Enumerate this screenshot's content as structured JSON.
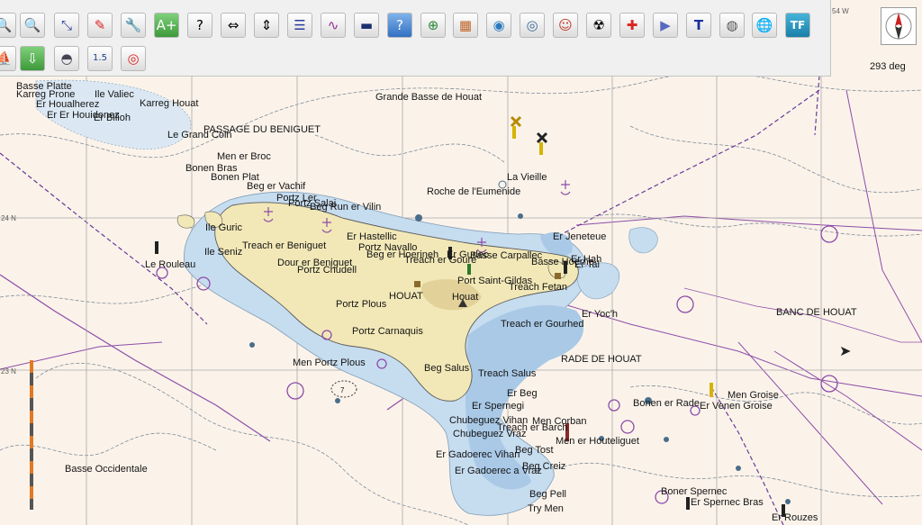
{
  "toolbar": {
    "buttons": [
      {
        "id": "zoom-in",
        "name": "zoom-in-icon",
        "glyph": "🔍"
      },
      {
        "id": "zoom-out",
        "name": "zoom-out-icon",
        "glyph": "🔍"
      },
      {
        "id": "route",
        "name": "route-icon",
        "glyph": "⤡"
      },
      {
        "id": "track",
        "name": "track-icon",
        "glyph": "✎"
      },
      {
        "id": "settings",
        "name": "wrench-icon",
        "glyph": "🔧"
      },
      {
        "id": "add-mark",
        "name": "add-waypoint-icon",
        "glyph": "A+"
      },
      {
        "id": "query",
        "name": "query-icon",
        "glyph": "?"
      },
      {
        "id": "stretch-h",
        "name": "horizontal-stretch-icon",
        "glyph": "⇔"
      },
      {
        "id": "stretch-v",
        "name": "vertical-stretch-icon",
        "glyph": "⇕"
      },
      {
        "id": "route-manager",
        "name": "route-manager-icon",
        "glyph": "☰"
      },
      {
        "id": "tracks",
        "name": "track-manager-icon",
        "glyph": "∿"
      },
      {
        "id": "depth",
        "name": "depth-icon",
        "glyph": "▬"
      },
      {
        "id": "help",
        "name": "help-icon",
        "glyph": "?"
      },
      {
        "id": "target",
        "name": "target-icon",
        "glyph": "⊕"
      },
      {
        "id": "weather",
        "name": "weather-map-icon",
        "glyph": "▦"
      },
      {
        "id": "layers",
        "name": "layers-icon",
        "glyph": "◉"
      },
      {
        "id": "charts",
        "name": "chart-group-icon",
        "glyph": "◎"
      },
      {
        "id": "mob",
        "name": "man-overboard-icon",
        "glyph": "☺"
      },
      {
        "id": "ais",
        "name": "ais-antenna-icon",
        "glyph": "☢"
      },
      {
        "id": "alert",
        "name": "alert-icon",
        "glyph": "✚"
      },
      {
        "id": "dashboard",
        "name": "dashboard-icon",
        "glyph": "▶"
      },
      {
        "id": "text",
        "name": "text-tool-icon",
        "glyph": "T"
      },
      {
        "id": "radar",
        "name": "radar-icon",
        "glyph": "◍"
      },
      {
        "id": "globe",
        "name": "globe-icon",
        "glyph": "🌐"
      },
      {
        "id": "tf",
        "name": "tf-plugin-icon",
        "glyph": "TF"
      },
      {
        "id": "boat",
        "name": "boat-icon",
        "glyph": "⛵"
      },
      {
        "id": "download",
        "name": "download-icon",
        "glyph": "⇩"
      },
      {
        "id": "grib",
        "name": "grib-icon",
        "glyph": "◓"
      },
      {
        "id": "scale",
        "name": "scale-badge-icon",
        "glyph": "1.5"
      },
      {
        "id": "lifebuoy",
        "name": "lifebuoy-icon",
        "glyph": "◎"
      }
    ]
  },
  "status": {
    "heading": "293 deg",
    "lon_top": "54 W",
    "lat_24": "24 N",
    "lat_23": "23 N",
    "compass_icon": "north-arrow-icon"
  },
  "colors": {
    "land": "#f2e8b7",
    "sea": "#fbf3ea",
    "shallow": "#a9c9e6",
    "deep_shallow": "#c6dcef",
    "route_line": "#8d4ca8",
    "grid": "#a8a8a8"
  },
  "labels": [
    {
      "id": "basse-platte",
      "text": "Basse Platte"
    },
    {
      "id": "karreg-prone",
      "text": "Karreg Prone"
    },
    {
      "id": "ile-valiec",
      "text": "Ile Valiec"
    },
    {
      "id": "er-houalherez",
      "text": "Er Houalherez"
    },
    {
      "id": "karreg-houat",
      "text": "Karreg Houat"
    },
    {
      "id": "er-houidenez",
      "text": "Er Er Houidenez"
    },
    {
      "id": "er-bilioh",
      "text": "Er Bilioh"
    },
    {
      "id": "grande-basse",
      "text": "Grande Basse de Houat"
    },
    {
      "id": "passage",
      "text": "PASSAGE DU BENIGUET"
    },
    {
      "id": "le-grand-coin",
      "text": "Le Grand Coin"
    },
    {
      "id": "men-er-broc",
      "text": "Men er Broc"
    },
    {
      "id": "bonen-bras",
      "text": "Bonen Bras"
    },
    {
      "id": "bonen-plat",
      "text": "Bonen Plat"
    },
    {
      "id": "la-vieille",
      "text": "La Vieille"
    },
    {
      "id": "beg-er-vachif",
      "text": "Beg er Vachif"
    },
    {
      "id": "roche-eumenide",
      "text": "Roche de l'Eumenide"
    },
    {
      "id": "portz-ler",
      "text": "Portz Ler"
    },
    {
      "id": "portz-salai",
      "text": "Portz Salai"
    },
    {
      "id": "beg-run",
      "text": "Beg Run er Vilin"
    },
    {
      "id": "er-jeneteue",
      "text": "Er Jeneteue"
    },
    {
      "id": "ile-guric",
      "text": "Ile Guric"
    },
    {
      "id": "er-hastellic",
      "text": "Er Hastellic"
    },
    {
      "id": "treach-beniguet",
      "text": "Treach er Beniguet"
    },
    {
      "id": "portz-navallo",
      "text": "Portz Navallo"
    },
    {
      "id": "ile-seniz",
      "text": "Ile Seniz"
    },
    {
      "id": "beg-er-hoeriheh",
      "text": "Beg er Hoerineh"
    },
    {
      "id": "er-gurlec",
      "text": "Er Gurlec"
    },
    {
      "id": "basse-carpallec",
      "text": "Basse Carpallec"
    },
    {
      "id": "er-hah",
      "text": "Er Hah"
    },
    {
      "id": "treach-er-gourre",
      "text": "Treach er Goure"
    },
    {
      "id": "basse-hoerne",
      "text": "Basse Hoerne"
    },
    {
      "id": "er-tal",
      "text": "Er Tal"
    },
    {
      "id": "le-rouleau",
      "text": "Le Rouleau"
    },
    {
      "id": "dour-er-beniguet",
      "text": "Dour er Beniguet"
    },
    {
      "id": "portz-chudell",
      "text": "Portz Chudell"
    },
    {
      "id": "port-saint-gildas",
      "text": "Port Saint-Gildas"
    },
    {
      "id": "treach-fetan",
      "text": "Treach Fetan"
    },
    {
      "id": "houat-caps",
      "text": "HOUAT"
    },
    {
      "id": "houat",
      "text": "Houat"
    },
    {
      "id": "portz-plous",
      "text": "Portz Plous"
    },
    {
      "id": "er-yoch",
      "text": "Er Yoc'h"
    },
    {
      "id": "banc-de-houat",
      "text": "BANC DE HOUAT"
    },
    {
      "id": "treach-er-gourhed",
      "text": "Treach er Gourhed"
    },
    {
      "id": "portz-carnaquis",
      "text": "Portz Carnaquis"
    },
    {
      "id": "rade-de-houat",
      "text": "RADE DE HOUAT"
    },
    {
      "id": "men-portz-plous",
      "text": "Men Portz Plous"
    },
    {
      "id": "beg-salus",
      "text": "Beg Salus"
    },
    {
      "id": "treach-salus",
      "text": "Treach Salus"
    },
    {
      "id": "er-beg",
      "text": "Er Beg"
    },
    {
      "id": "men-groise",
      "text": "Men Groise"
    },
    {
      "id": "bonen-er-rade",
      "text": "Bonen er Rade"
    },
    {
      "id": "er-venen-groise",
      "text": "Er Venen Groise"
    },
    {
      "id": "er-spernegi",
      "text": "Er Spernegi"
    },
    {
      "id": "chubeguez-vihan",
      "text": "Chubeguez Vihan"
    },
    {
      "id": "men-corban",
      "text": "Men Corban"
    },
    {
      "id": "treach-er-barch",
      "text": "Treach er Barch"
    },
    {
      "id": "chubeguez-vraz",
      "text": "Chubeguez Vraz"
    },
    {
      "id": "men-er-houteliguet",
      "text": "Men er Houteliguet"
    },
    {
      "id": "beg-tost",
      "text": "Beg Tost"
    },
    {
      "id": "er-gadoerec-vihan",
      "text": "Er Gadoerec Vihan"
    },
    {
      "id": "basse-occidentale",
      "text": "Basse Occidentale"
    },
    {
      "id": "beg-creiz",
      "text": "Beg Creiz"
    },
    {
      "id": "er-gadoerec-vraz",
      "text": "Er Gadoerec a Vraz"
    },
    {
      "id": "beg-pell",
      "text": "Beg Pell"
    },
    {
      "id": "boner-spernec",
      "text": "Boner Spernec"
    },
    {
      "id": "er-spernec-bras",
      "text": "Er Spernec Bras"
    },
    {
      "id": "try-men",
      "text": "Try Men"
    },
    {
      "id": "er-rouzes",
      "text": "Er Rouzes"
    },
    {
      "id": "sounding-7",
      "text": "7"
    }
  ]
}
